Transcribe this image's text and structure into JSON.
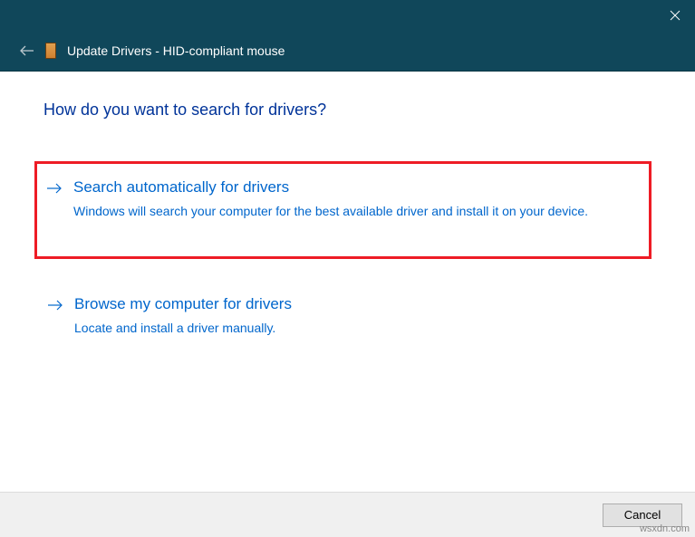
{
  "titlebar": {},
  "header": {
    "title": "Update Drivers - HID-compliant mouse"
  },
  "content": {
    "question": "How do you want to search for drivers?",
    "options": [
      {
        "title": "Search automatically for drivers",
        "description": "Windows will search your computer for the best available driver and install it on your device."
      },
      {
        "title": "Browse my computer for drivers",
        "description": "Locate and install a driver manually."
      }
    ]
  },
  "footer": {
    "cancel_label": "Cancel"
  },
  "watermark": "wsxdn.com"
}
